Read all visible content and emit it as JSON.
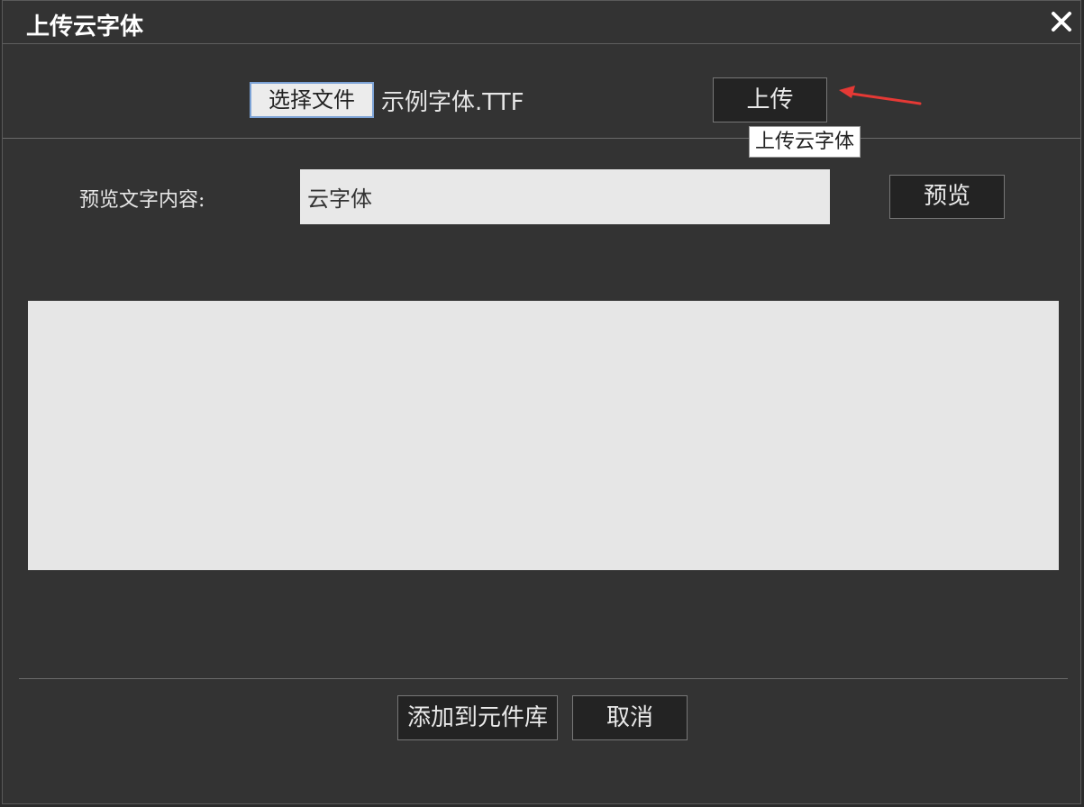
{
  "dialog": {
    "title": "上传云字体",
    "close_icon": "close-icon"
  },
  "upload_row": {
    "choose_file_label": "选择文件",
    "file_name": "示例字体.TTF",
    "upload_label": "上传",
    "tooltip": "上传云字体"
  },
  "preview_row": {
    "label": "预览文字内容:",
    "input_value": "云字体",
    "preview_label": "预览"
  },
  "footer": {
    "add_label": "添加到元件库",
    "cancel_label": "取消"
  },
  "colors": {
    "background": "#333333",
    "arrow": "#e53935",
    "preview_area": "#e6e6e6"
  }
}
